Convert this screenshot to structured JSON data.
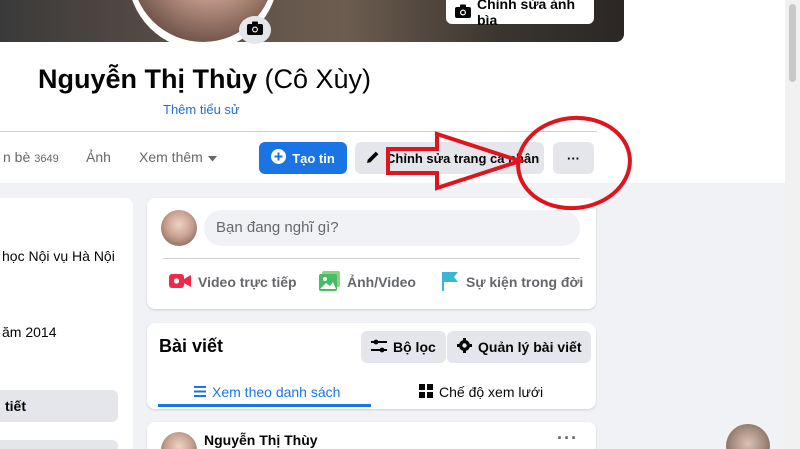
{
  "cover": {
    "edit_cover_label": "Chỉnh sửa ảnh bìa"
  },
  "profile": {
    "name": "Nguyễn Thị Thùy",
    "nickname": "(Cô Xùy)",
    "add_bio_label": "Thêm tiểu sử"
  },
  "tabs": {
    "friends_label": "n bè",
    "friends_count": "3649",
    "photos_label": "Ảnh",
    "more_label": "Xem thêm"
  },
  "actions": {
    "add_story_label": "Tạo tin",
    "edit_profile_label": "Chỉnh sửa trang cá nhân",
    "more_options_label": "···"
  },
  "intro": {
    "school_text": "học Nội vụ Hà Nội",
    "year_text": "ăm 2014",
    "edit_details_label": "tiết"
  },
  "composer": {
    "placeholder": "Bạn đang nghĩ gì?",
    "live_video_label": "Video trực tiếp",
    "photo_video_label": "Ảnh/Video",
    "life_event_label": "Sự kiện trong đời"
  },
  "posts": {
    "title": "Bài viết",
    "filter_label": "Bộ lọc",
    "manage_label": "Quản lý bài viết",
    "list_view_label": "Xem theo danh sách",
    "grid_view_label": "Chế độ xem lưới"
  },
  "post": {
    "author": "Nguyễn Thị Thùy",
    "more_label": "···"
  },
  "colors": {
    "primary_blue": "#1b74e4",
    "link_blue": "#216fdb",
    "annotation_red": "#e0141e",
    "page_background": "#f0f2f5",
    "button_gray": "#e4e6eb"
  }
}
